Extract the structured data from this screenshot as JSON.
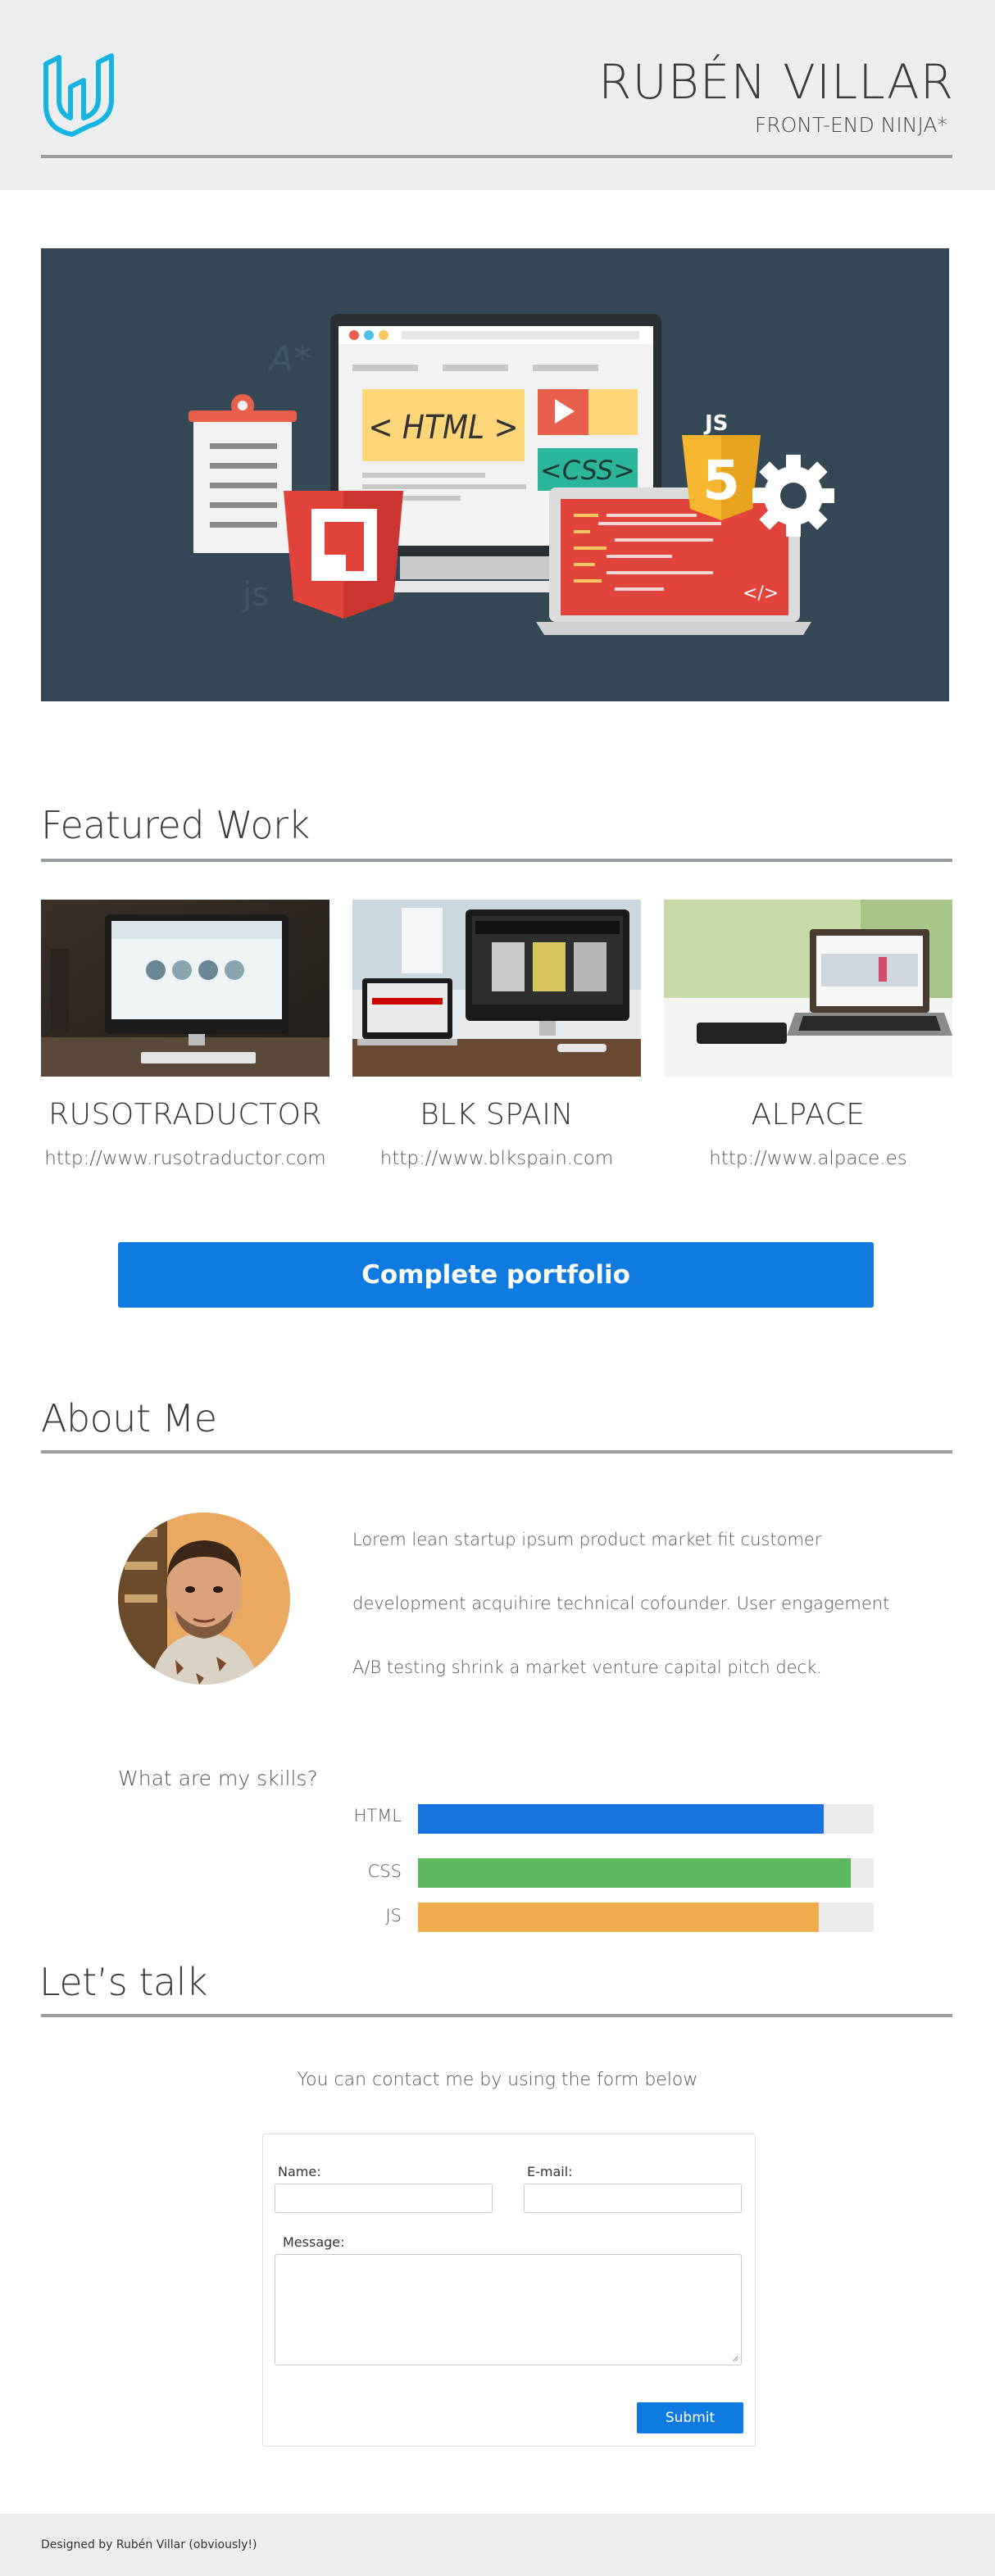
{
  "header": {
    "name": "RUBÉN VILLAR",
    "subtitle": "FRONT-END NINJA*",
    "logo_icon": "udacity-logo-icon",
    "logo_color": "#15b4e3"
  },
  "hero": {
    "screen_html_label": "< HTML >",
    "screen_css_label": "<CSS>",
    "badge_js": "JS",
    "badge_5": "5",
    "code_tag": "</>"
  },
  "featured": {
    "title": "Featured Work",
    "items": [
      {
        "title": "RUSOTRADUCTOR",
        "url": "http://www.rusotraductor.com"
      },
      {
        "title": "BLK SPAIN",
        "url": "http://www.blkspain.com"
      },
      {
        "title": "ALPACE",
        "url": "http://www.alpace.es"
      }
    ],
    "button_label": "Complete portfolio"
  },
  "about": {
    "title": "About Me",
    "text": "Lorem lean startup ipsum product market fit customer development acquihire technical cofounder. User engagement A/B testing shrink a market venture capital pitch deck.",
    "skills_title": "What are my skills?",
    "skills": [
      {
        "name": "HTML",
        "level": 0.89,
        "color": "#1674df"
      },
      {
        "name": "CSS",
        "level": 0.95,
        "color": "#5cb85c"
      },
      {
        "name": "JS",
        "level": 0.88,
        "color": "#f0ad4e"
      }
    ]
  },
  "contact": {
    "title": "Let’s talk",
    "intro": "You can contact me by using the form below",
    "name_label": "Name:",
    "email_label": "E-mail:",
    "message_label": "Message:",
    "name_value": "",
    "email_value": "",
    "message_value": "",
    "submit_label": "Submit"
  },
  "footer": {
    "text": "Designed by Rubén Villar (obviously!)"
  },
  "colors": {
    "accent": "#0f7ae0",
    "header_bg": "#ecedee",
    "hero_bg": "#344955"
  }
}
